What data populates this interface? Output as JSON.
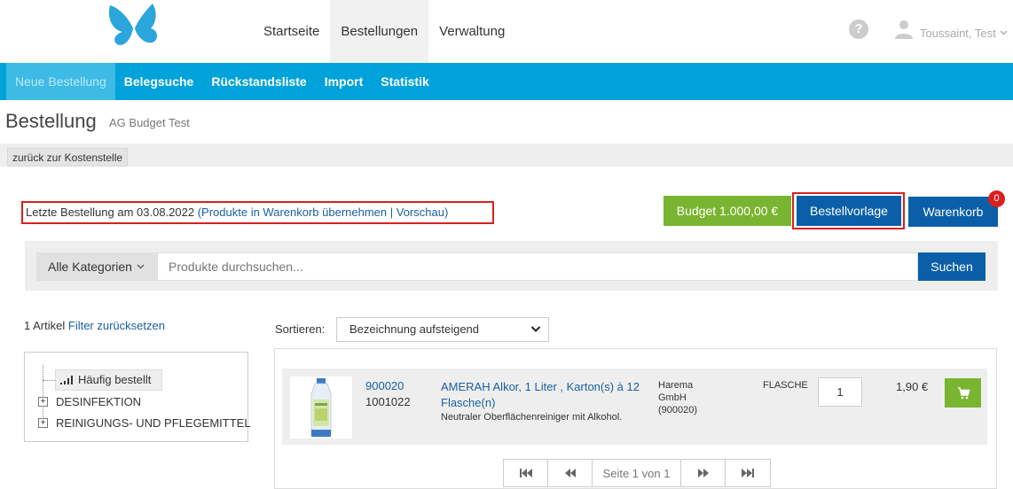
{
  "header": {
    "nav": [
      {
        "label": "Startseite",
        "active": false
      },
      {
        "label": "Bestellungen",
        "active": true
      },
      {
        "label": "Verwaltung",
        "active": false
      }
    ],
    "user_name": "Toussaint, Test",
    "help_glyph": "?",
    "brand_color": "#2aa6dc"
  },
  "subnav": [
    {
      "label": "Neue Bestellung",
      "active": true
    },
    {
      "label": "Belegsuche",
      "active": false
    },
    {
      "label": "Rückstandsliste",
      "active": false
    },
    {
      "label": "Import",
      "active": false
    },
    {
      "label": "Statistik",
      "active": false
    }
  ],
  "page": {
    "title": "Bestellung",
    "subtitle": "AG Budget Test",
    "back_label": "zurück zur Kostenstelle"
  },
  "last_order": {
    "prefix": "Letzte Bestellung am 03.08.2022",
    "open_paren": " (",
    "take_over_label": "Produkte in Warenkorb übernehmen",
    "separator": " | ",
    "preview_label": "Vorschau",
    "close_paren": ")"
  },
  "actions": {
    "budget_label": "Budget 1.000,00 €",
    "template_label": "Bestellvorlage",
    "cart_label": "Warenkorb",
    "cart_count": "0"
  },
  "search": {
    "category_label": "Alle Kategorien",
    "placeholder": "Produkte durchsuchen...",
    "submit_label": "Suchen"
  },
  "filter": {
    "count_label": "1 Artikel",
    "reset_label": "Filter zurücksetzen"
  },
  "tree": {
    "selected_label": "Häufig bestellt",
    "items": [
      "DESINFEKTION",
      "REINIGUNGS- UND PFLEGEMITTEL"
    ]
  },
  "sort": {
    "label": "Sortieren:",
    "selected": "Bezeichnung aufsteigend"
  },
  "products": [
    {
      "article_nr": "900020",
      "article_nr2": "1001022",
      "name": "AMERAH Alkor, 1 Liter , Karton(s) à 12 Flasche(n)",
      "description": "Neutraler Oberflächenreiniger mit Alkohol.",
      "manufacturer_line1": "Harema",
      "manufacturer_line2": "GmbH",
      "manufacturer_line3": "(900020)",
      "unit": "FLASCHE",
      "quantity": "1",
      "price": "1,90 €"
    }
  ],
  "pagination": {
    "info": "Seite 1 von 1"
  },
  "colors": {
    "subnav_bg": "#00a3d9",
    "primary_button": "#0b5fa8",
    "success_button": "#79b530",
    "highlight_border": "#d9201f",
    "link": "#1a5f9e"
  }
}
